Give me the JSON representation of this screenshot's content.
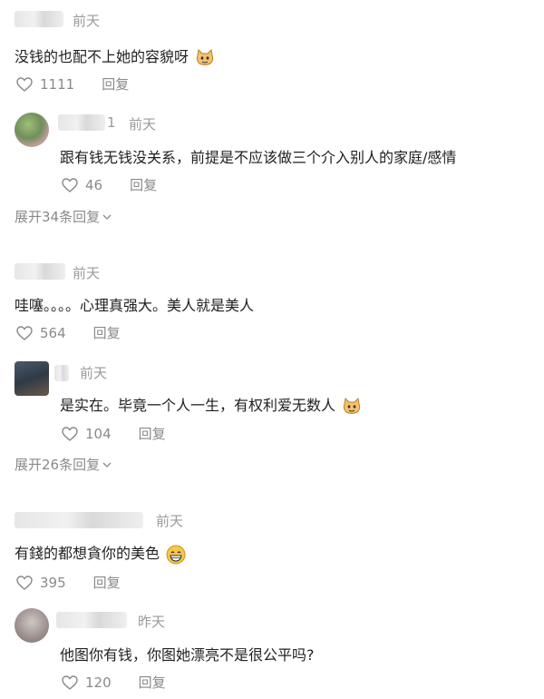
{
  "comments": [
    {
      "time": "前天",
      "text": "没钱的也配不上她的容貌呀",
      "likes": "1111",
      "reply": "回复"
    },
    {
      "suffix": "1",
      "time": "前天",
      "text": "跟有钱无钱没关系，前提是不应该做三个介入别人的家庭/感情",
      "likes": "46",
      "reply": "回复",
      "expand": "展开34条回复"
    },
    {
      "time": "前天",
      "text": "哇噻。。。。心理真强大。美人就是美人",
      "likes": "564",
      "reply": "回复"
    },
    {
      "time": "前天",
      "text": "是实在。毕竟一个人一生，有权利爱无数人",
      "likes": "104",
      "reply": "回复",
      "expand": "展开26条回复"
    },
    {
      "time": "前天",
      "text": "有錢的都想貪你的美色",
      "likes": "395",
      "reply": "回复"
    },
    {
      "time": "昨天",
      "text": "他图你有钱，你图她漂亮不是很公平吗?",
      "likes": "120",
      "reply": "回复"
    }
  ],
  "icons": {
    "like": "heart-outline-icon",
    "expand": "chevron-down-icon",
    "emoji_cat": "cat-face-emoji",
    "emoji_grin": "grin-face-emoji"
  }
}
